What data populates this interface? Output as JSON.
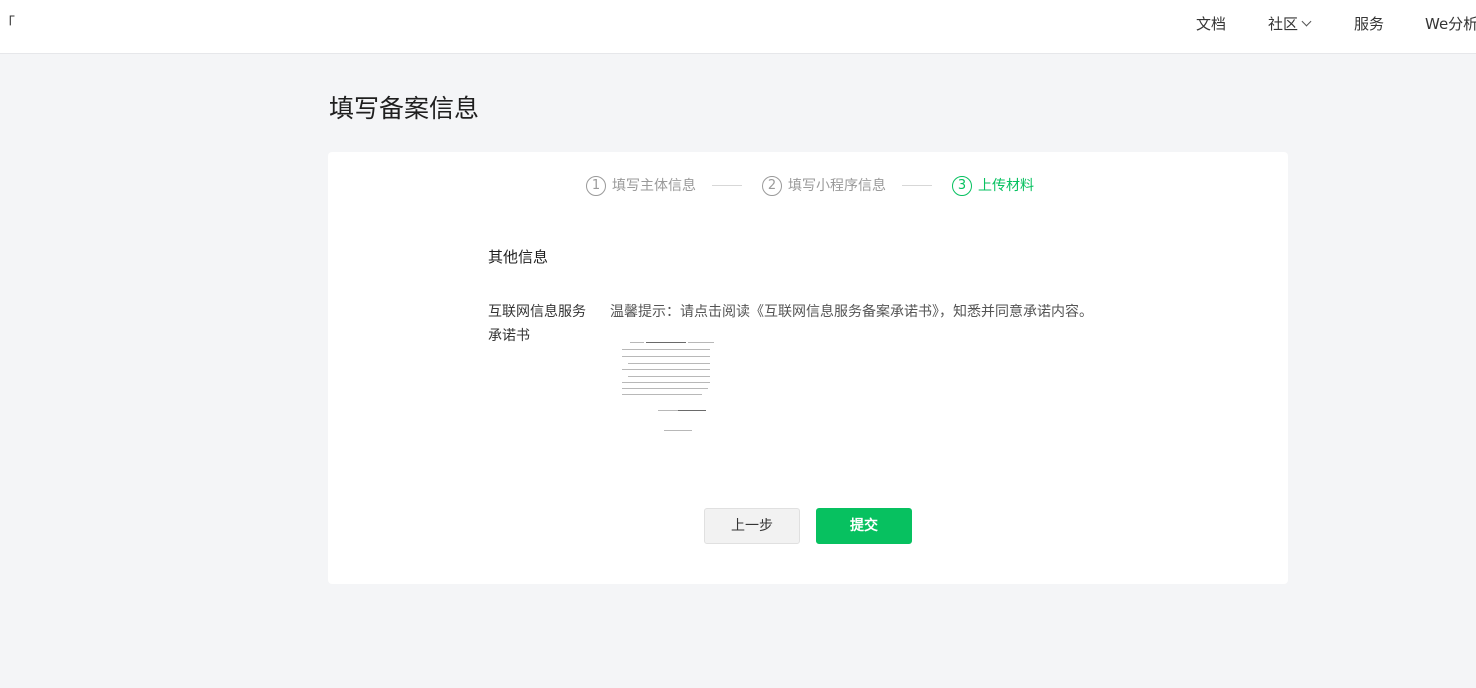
{
  "header": {
    "left_fragment": "「",
    "nav": [
      {
        "label": "文档"
      },
      {
        "label": "社区"
      },
      {
        "label": "服务"
      },
      {
        "label": "We分析"
      }
    ]
  },
  "page_title": "填写备案信息",
  "steps": [
    {
      "number": "1",
      "label": "填写主体信息",
      "state": "done"
    },
    {
      "number": "2",
      "label": "填写小程序信息",
      "state": "done"
    },
    {
      "number": "3",
      "label": "上传材料",
      "state": "active"
    }
  ],
  "section_title": "其他信息",
  "field": {
    "label": "互联网信息服务承诺书",
    "hint": "温馨提示：请点击阅读《互联网信息服务备案承诺书》，知悉并同意承诺内容。"
  },
  "buttons": {
    "prev": "上一步",
    "submit": "提交"
  },
  "colors": {
    "accent": "#07c160",
    "background": "#f4f5f7"
  }
}
